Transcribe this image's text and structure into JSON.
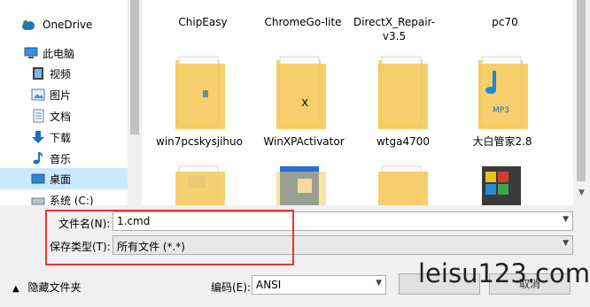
{
  "sidebar": {
    "items": [
      {
        "label": "OneDrive",
        "icon": "onedrive-cloud-icon"
      },
      {
        "label": "此电脑",
        "icon": "computer-icon"
      },
      {
        "label": "视频",
        "icon": "video-icon"
      },
      {
        "label": "图片",
        "icon": "picture-icon"
      },
      {
        "label": "文档",
        "icon": "document-icon"
      },
      {
        "label": "下载",
        "icon": "download-arrow-icon"
      },
      {
        "label": "音乐",
        "icon": "music-note-icon"
      },
      {
        "label": "桌面",
        "icon": "desktop-icon"
      },
      {
        "label": "系统 (C:)",
        "icon": "drive-icon"
      }
    ]
  },
  "files": [
    {
      "name": "ChipEasy"
    },
    {
      "name": "ChromeGo-lite"
    },
    {
      "name": "DirectX_Repair-v3.5"
    },
    {
      "name": "pc70"
    },
    {
      "name": "win7pcskysjihuo"
    },
    {
      "name": "WinXPActivator"
    },
    {
      "name": "wtga4700"
    },
    {
      "name": "大白管家2.8"
    }
  ],
  "form": {
    "filename_label": "文件名(N):",
    "filename_value": "1.cmd",
    "filetype_label": "保存类型(T):",
    "filetype_value": "所有文件  (*.*)"
  },
  "footer": {
    "hide_folders_label": "隐藏文件夹",
    "encoding_label": "编码(E):",
    "encoding_value": "ANSI",
    "save_label": "",
    "cancel_label": "取消"
  },
  "watermark": "leisu123.com",
  "colors": {
    "selected": "#cce8ff",
    "highlight_border": "#e53935",
    "folder": "#f5c95c"
  }
}
